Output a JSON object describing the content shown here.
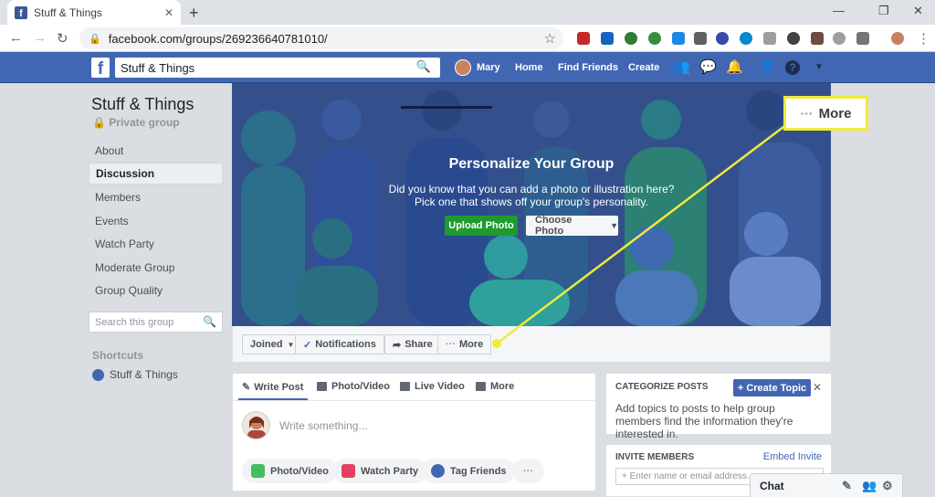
{
  "browser": {
    "tab_title": "Stuff & Things",
    "tab_close": "✕",
    "new_tab": "+",
    "url": "facebook.com/groups/269236640781010/",
    "win_min": "—",
    "win_max": "❐",
    "win_close": "✕"
  },
  "fbbar": {
    "logo": "f",
    "search_value": "Stuff & Things",
    "user": "Mary",
    "home": "Home",
    "find_friends": "Find Friends",
    "create": "Create"
  },
  "sidebar": {
    "group_name": "Stuff & Things",
    "privacy": "Private group",
    "nav": [
      "About",
      "Discussion",
      "Members",
      "Events",
      "Watch Party",
      "Moderate Group",
      "Group Quality"
    ],
    "search_placeholder": "Search this group",
    "shortcuts_heading": "Shortcuts",
    "shortcut_item": "Stuff & Things"
  },
  "cover": {
    "title": "Personalize Your Group",
    "text_line1": "Did you know that you can add a photo or illustration here?",
    "text_line2": "Pick one that shows off your group's personality.",
    "upload_label": "Upload Photo",
    "choose_label": "Choose Photo"
  },
  "actionbar": {
    "joined": "Joined",
    "notifications": "Notifications",
    "share": "Share",
    "more": "More"
  },
  "composer": {
    "tabs": [
      "Write Post",
      "Photo/Video",
      "Live Video",
      "More"
    ],
    "placeholder": "Write something...",
    "pills": [
      "Photo/Video",
      "Watch Party",
      "Tag Friends"
    ],
    "pill_more": "···"
  },
  "categorize": {
    "heading": "CATEGORIZE POSTS",
    "button": "+ Create Topic",
    "close": "✕",
    "description": "Add topics to posts to help group members find the information they're interested in."
  },
  "invite": {
    "heading": "INVITE MEMBERS",
    "embed": "Embed Invite",
    "placeholder": "+ Enter name or email address..."
  },
  "chat": {
    "label": "Chat"
  },
  "callout": {
    "dots": "···",
    "label": "More"
  },
  "colors": {
    "fb_blue": "#4267b2",
    "highlight_yellow": "#f0ea3c",
    "upload_green": "#1f9a2e"
  }
}
